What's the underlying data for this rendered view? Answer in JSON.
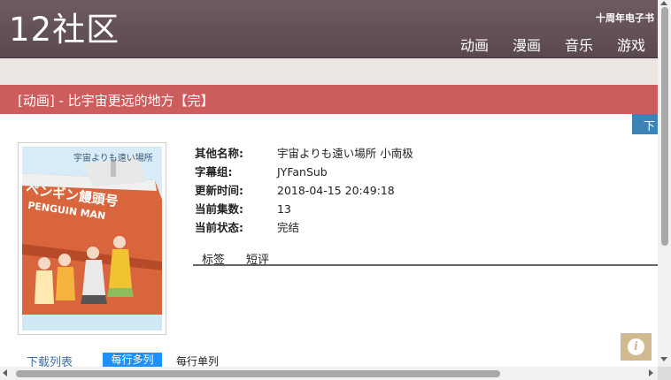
{
  "header": {
    "logo": "12社区",
    "tagline": "十周年电子书",
    "nav": [
      "动画",
      "漫画",
      "音乐",
      "游戏"
    ]
  },
  "title_bar": {
    "title": "[动画] - 比宇宙更远的地方【完】"
  },
  "download_tab": "下",
  "poster": {
    "title_text": "宇宙よりも遠い場所",
    "ship_text": "ペンギン饅頭号",
    "ship_text_en": "PENGUIN MAN"
  },
  "info": [
    {
      "key": "其他名称:",
      "value": "宇宙よりも遠い場所 小南极"
    },
    {
      "key": "字幕组:",
      "value": "JYFanSub"
    },
    {
      "key": "更新时间:",
      "value": "2018-04-15 20:49:18"
    },
    {
      "key": "当前集数:",
      "value": "13"
    },
    {
      "key": "当前状态:",
      "value": "完结"
    }
  ],
  "tabs": [
    "标签",
    "短评"
  ],
  "download_list": {
    "label": "下载列表",
    "mode_multi": "每行多列",
    "mode_single": "每行单列"
  },
  "info_button_icon": "info-icon",
  "colors": {
    "header_bg": "#5f4c55",
    "title_bar_bg": "#cd5c5c",
    "subbar_bg": "#ece6e3",
    "download_tab_bg": "#3e83b5",
    "active_mode_bg": "#1e90ff",
    "info_button_bg": "#d1ba8f"
  }
}
